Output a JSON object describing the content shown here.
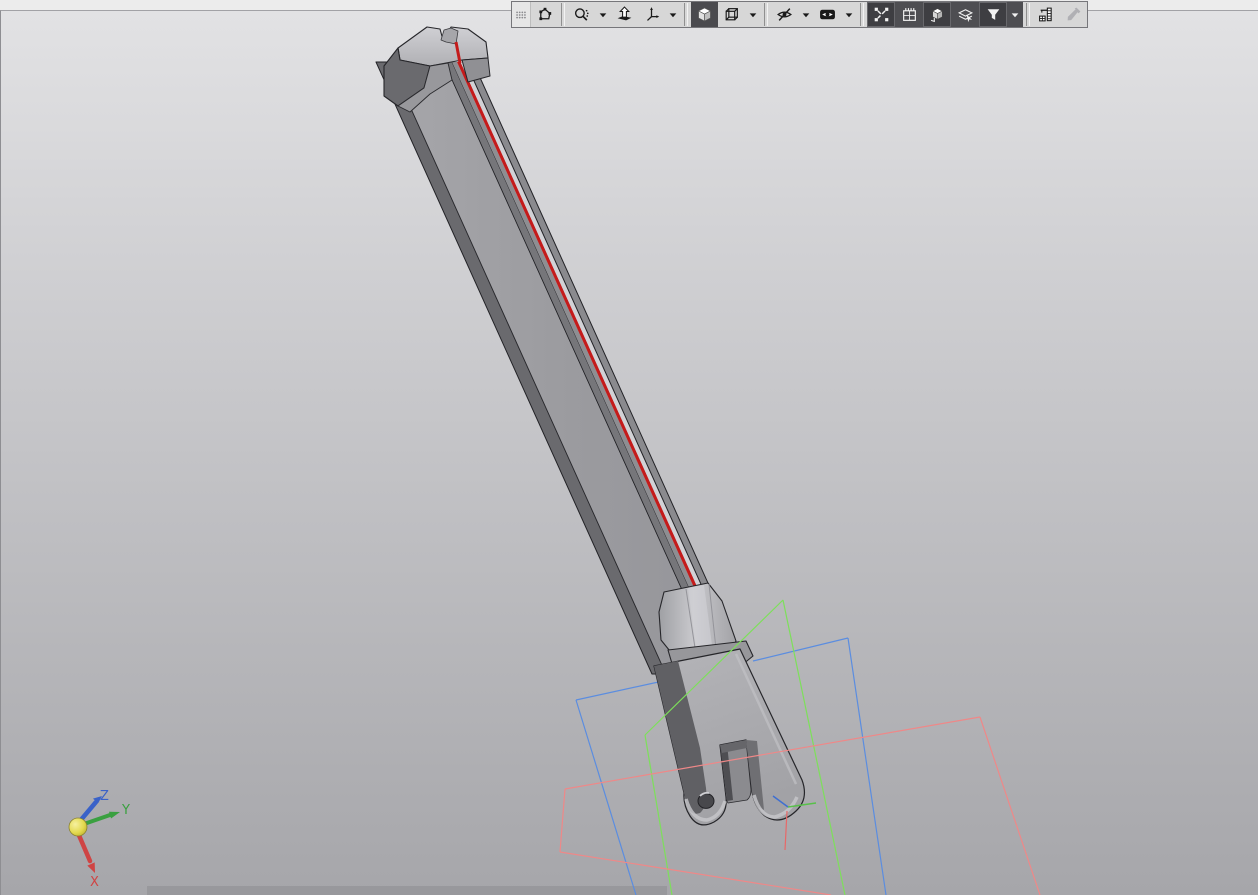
{
  "toolbar": {
    "buttons": [
      {
        "id": "toolbar-grip",
        "kind": "grip",
        "icon": "grip"
      },
      {
        "id": "selection-contour",
        "icon": "contour-nodes"
      },
      {
        "kind": "sep"
      },
      {
        "id": "zoom-tools",
        "icon": "magnifier",
        "dropdown": true
      },
      {
        "id": "orientation-normal-to",
        "icon": "arrow-up-plane"
      },
      {
        "id": "orientation-views",
        "icon": "axes-triad",
        "dropdown": true
      },
      {
        "kind": "sep"
      },
      {
        "id": "display-shaded",
        "icon": "cube-shaded",
        "pressed": "light"
      },
      {
        "id": "display-wireframe",
        "icon": "cube-wireframe",
        "dropdown": true
      },
      {
        "kind": "sep"
      },
      {
        "id": "hidden-lines",
        "icon": "eye-slash",
        "dropdown": true
      },
      {
        "id": "show-hidden-objects",
        "icon": "eye-frame",
        "dropdown": true
      },
      {
        "kind": "sep"
      },
      {
        "id": "snap-endpoints",
        "icon": "endpoint-dots",
        "dark": true,
        "pressed": "dark"
      },
      {
        "id": "grid-display",
        "icon": "grid-pad",
        "dark": true
      },
      {
        "id": "construction-objects",
        "icon": "cube-sheet",
        "dark": true,
        "pressed": "dark"
      },
      {
        "id": "layers",
        "icon": "sheets-cursor",
        "dark": true
      },
      {
        "id": "selection-filter",
        "icon": "funnel",
        "dark": true,
        "pressed": "dark",
        "dropdown": true
      },
      {
        "kind": "sep"
      },
      {
        "id": "measure-tools",
        "icon": "column-gauge"
      },
      {
        "id": "eyedropper",
        "icon": "eyedropper",
        "disabled": true
      }
    ]
  },
  "viewport": {
    "triad": {
      "x_label": "X",
      "y_label": "Y",
      "z_label": "Z"
    },
    "construction_planes": [
      {
        "name": "plane-blue",
        "color": "#5b8de0"
      },
      {
        "name": "plane-green",
        "color": "#7de05a"
      },
      {
        "name": "plane-red",
        "color": "#ef8888"
      }
    ]
  },
  "colors": {
    "app_strip": "#ececec",
    "viewport_top": "#e2e2e4",
    "viewport_bottom": "#a6a6aa",
    "toolbar_bg": "#d7d7d7",
    "toolbar_dark": "#4e4e52",
    "toolbar_border": "#76767a",
    "part_front": "#9d9da1",
    "part_flank": "#6a6a6e",
    "part_groove": "#76767a",
    "part_bright": "#d2d2d6",
    "edge_red": "#c41b1b",
    "plane_blue": "#5b8de0",
    "plane_green": "#7de05a",
    "plane_red": "#ef8888",
    "axis_x": "#cf4444",
    "axis_y": "#3aa040",
    "axis_z": "#3a62c8",
    "origin_ball": "#e3d94e"
  }
}
